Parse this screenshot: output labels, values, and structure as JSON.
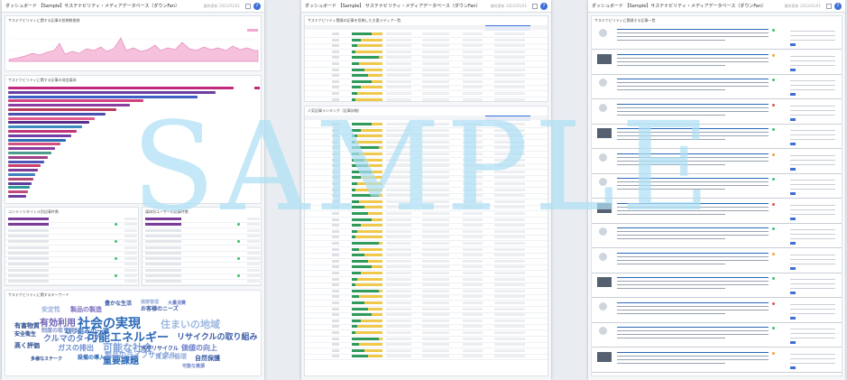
{
  "header": {
    "panel1_title": "ダッシュボード 【Sample】サステナビリティ・メディアデータベース（ダウンFan）",
    "panel2_title": "ダッシュボード 【Sample】 サステナビリティ・メディアデータベース（ダウンFan）",
    "panel3_title": "ダッシュボード 【Sample】サステナビリティ・メディアデータベース（ダウンFan）",
    "meta": "最終更新 2022/01/01",
    "help_icon": "?"
  },
  "panel1": {
    "area_chart_title": "サステナビリティに関する記事の投稿数推移",
    "hbar_title": "サステナビリティに関する記事の発信媒体",
    "small_table_left_title": "コンテンツタイトル別記事件数",
    "small_table_right_title": "媒体別ユーザーの記事件数",
    "wordcloud_title": "サステナビリティに関するキーワード"
  },
  "panel2": {
    "table1_title": "サステナビリティ関連の記事を投稿した主要メディア一覧",
    "table2_title": "人気記事ランキング（記事詳細）"
  },
  "panel3": {
    "feed_title": "サステナビリティに関連する記事一覧"
  },
  "wordcloud": [
    "社会の実現",
    "可能エネルギー",
    "有効利用",
    "可能な社会",
    "住まいの地域",
    "重要課題",
    "クルマのタイプ",
    "リサイクルの取り組み",
    "価値の向上",
    "有害物質",
    "製品の製造",
    "豊かな生活",
    "安定性",
    "お客様のニーズ",
    "取り組みの一環",
    "ガスの排出",
    "資源の循環",
    "自然保護",
    "制度の取り組み",
    "製品のライフサイクル",
    "安全衛生",
    "大量消費",
    "健康管理",
    "高く評価",
    "水平リサイクル",
    "多様なステーク",
    "設備の導入",
    "可能な資源"
  ],
  "colors": {
    "accent": "#e23b8a",
    "purple": "#6b3fa0",
    "wordcloud_blue": "#2a68b8",
    "watermark": "#aee0f4"
  },
  "watermark": "SAMPLE"
}
